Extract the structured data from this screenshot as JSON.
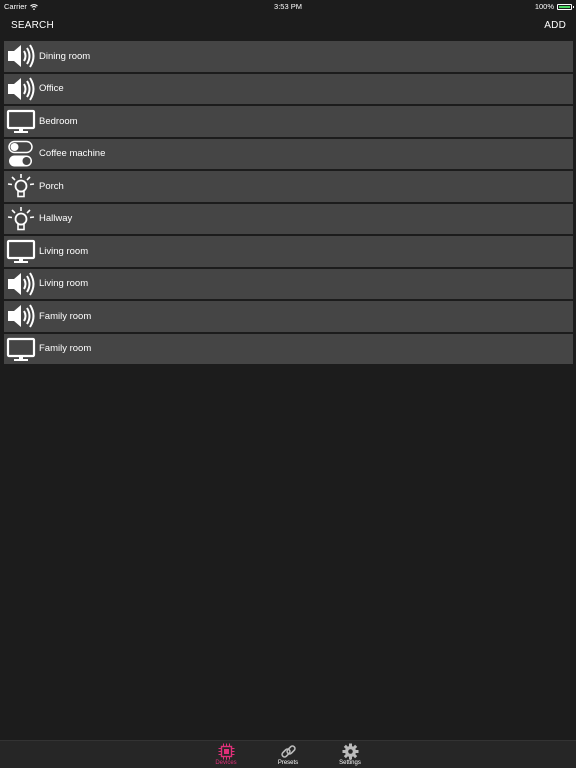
{
  "status_bar": {
    "carrier": "Carrier",
    "time": "3:53 PM",
    "battery_percent": "100%",
    "battery_level": 1.0,
    "battery_color": "#4cd964"
  },
  "nav": {
    "search_label": "SEARCH",
    "add_label": "ADD"
  },
  "devices": [
    {
      "icon": "speaker-icon",
      "label": "Dining room"
    },
    {
      "icon": "speaker-icon",
      "label": "Office"
    },
    {
      "icon": "tv-icon",
      "label": "Bedroom"
    },
    {
      "icon": "switch-icon",
      "label": "Coffee machine"
    },
    {
      "icon": "lightbulb-icon",
      "label": "Porch"
    },
    {
      "icon": "lightbulb-icon",
      "label": "Hallway"
    },
    {
      "icon": "tv-icon",
      "label": "Living room"
    },
    {
      "icon": "speaker-icon",
      "label": "Living room"
    },
    {
      "icon": "speaker-icon",
      "label": "Family room"
    },
    {
      "icon": "tv-icon",
      "label": "Family room"
    }
  ],
  "tabs": {
    "devices": "Devices",
    "presets": "Presets",
    "settings": "Settings"
  },
  "colors": {
    "background": "#1c1c1c",
    "row": "#454545",
    "accent": "#e0307a"
  }
}
